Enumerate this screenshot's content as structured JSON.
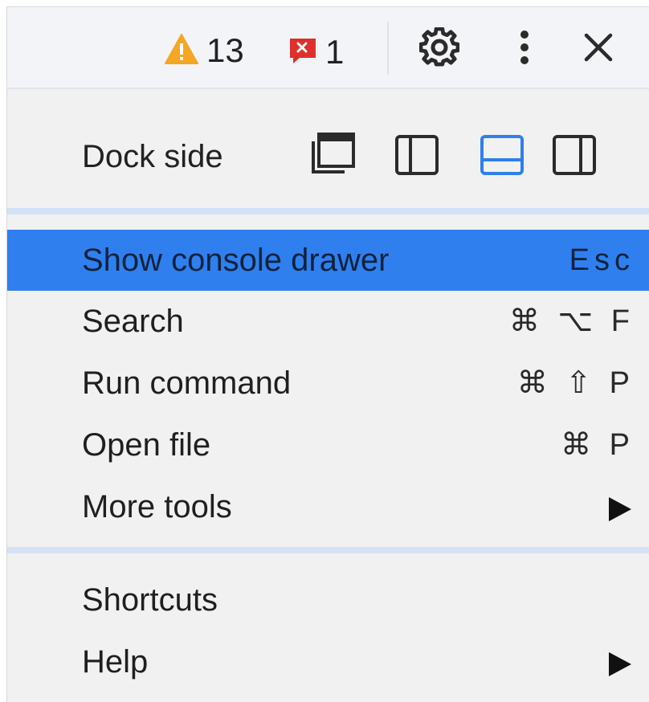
{
  "toolbar": {
    "warnings_count": "13",
    "errors_count": "1",
    "icons": [
      "warning-icon",
      "error-icon",
      "gear-icon",
      "kebab-menu-icon",
      "close-icon"
    ],
    "warning_color": "#f5a623",
    "error_color": "#e0302b"
  },
  "dock": {
    "label": "Dock side",
    "options": [
      "undock-into-separate-window",
      "dock-to-left",
      "dock-to-bottom",
      "dock-to-right"
    ],
    "selected": "dock-to-bottom",
    "selected_color": "#2f7fef"
  },
  "menu": {
    "group1": [
      {
        "label": "Show console drawer",
        "shortcut": "Esc",
        "highlighted": true
      },
      {
        "label": "Search",
        "shortcut": "⌘ ⌥ F"
      },
      {
        "label": "Run command",
        "shortcut": "⌘ ⇧ P"
      },
      {
        "label": "Open file",
        "shortcut": "⌘ P"
      },
      {
        "label": "More tools",
        "submenu": true
      }
    ],
    "group2": [
      {
        "label": "Shortcuts"
      },
      {
        "label": "Help",
        "submenu": true
      }
    ],
    "highlight_color": "#2f7fef"
  }
}
